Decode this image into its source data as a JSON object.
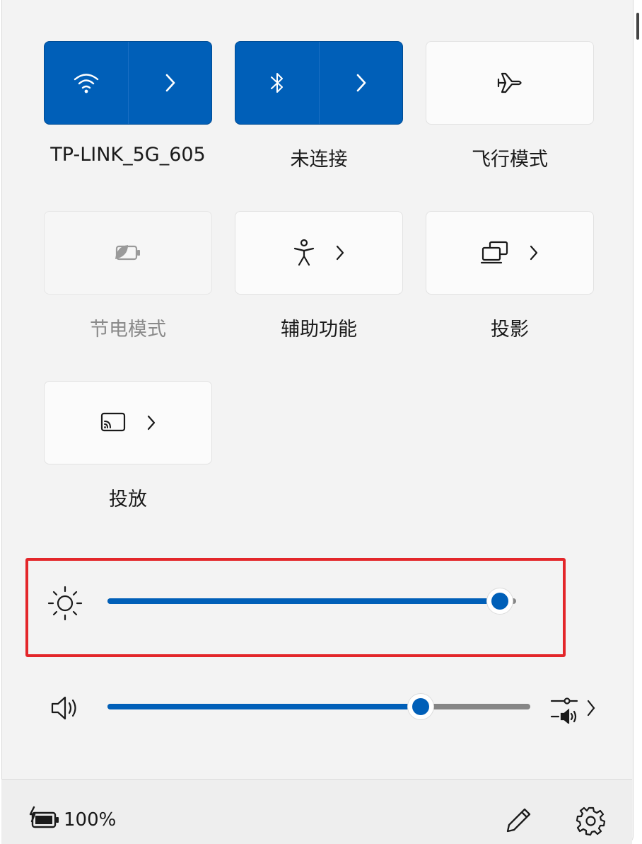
{
  "accent": "#005fb8",
  "tiles": [
    {
      "id": "wifi",
      "label": "TP-LINK_5G_605",
      "icon": "wifi-icon",
      "state": "on",
      "expand": true
    },
    {
      "id": "bluetooth",
      "label": "未连接",
      "icon": "bluetooth-icon",
      "state": "on",
      "expand": true
    },
    {
      "id": "airplane",
      "label": "飞行模式",
      "icon": "airplane-icon",
      "state": "off",
      "expand": false
    },
    {
      "id": "battery-saver",
      "label": "节电模式",
      "icon": "battery-saver-icon",
      "state": "disabled",
      "expand": false
    },
    {
      "id": "accessibility",
      "label": "辅助功能",
      "icon": "accessibility-icon",
      "state": "off",
      "expand": true
    },
    {
      "id": "project",
      "label": "投影",
      "icon": "project-icon",
      "state": "off",
      "expand": true
    },
    {
      "id": "cast",
      "label": "投放",
      "icon": "cast-icon",
      "state": "off",
      "expand": true
    }
  ],
  "brightness": {
    "icon": "brightness-icon",
    "level": 0.96
  },
  "volume": {
    "icon": "speaker-icon",
    "level": 0.74,
    "mixer_icon": "volume-mixer-icon"
  },
  "footer": {
    "battery_icon": "battery-charging-icon",
    "battery_percent": "100%",
    "edit_icon": "pencil-icon",
    "settings_icon": "gear-icon"
  }
}
